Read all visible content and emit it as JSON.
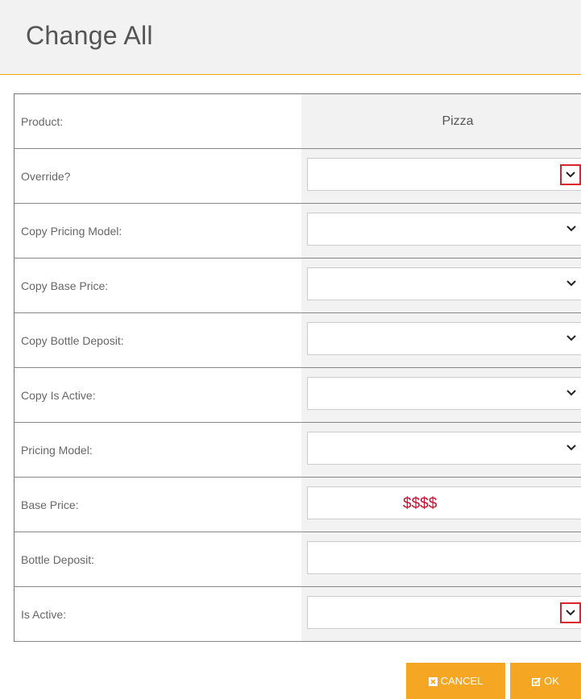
{
  "dialog": {
    "title": "Change All"
  },
  "product": {
    "label": "Product:",
    "value": "Pizza"
  },
  "fields": [
    {
      "label": "Override?",
      "type": "select",
      "value": ""
    },
    {
      "label": "Copy Pricing Model:",
      "type": "select",
      "value": ""
    },
    {
      "label": "Copy Base Price:",
      "type": "select",
      "value": ""
    },
    {
      "label": "Copy Bottle Deposit:",
      "type": "select",
      "value": ""
    },
    {
      "label": "Copy Is Active:",
      "type": "select",
      "value": ""
    },
    {
      "label": "Pricing Model:",
      "type": "select",
      "value": ""
    },
    {
      "label": "Base Price:",
      "type": "text",
      "value": "$$$$"
    },
    {
      "label": "Bottle Deposit:",
      "type": "text",
      "value": ""
    },
    {
      "label": "Is Active:",
      "type": "select",
      "value": ""
    }
  ],
  "buttons": {
    "cancel": "CANCEL",
    "ok": "OK"
  },
  "colors": {
    "accent": "#f5a623",
    "highlight": "#d9232d",
    "money": "#c8102e"
  },
  "icons": {
    "dropdown": "chevron-down-icon",
    "cancel": "close-box-icon",
    "ok": "checkbox-icon"
  }
}
